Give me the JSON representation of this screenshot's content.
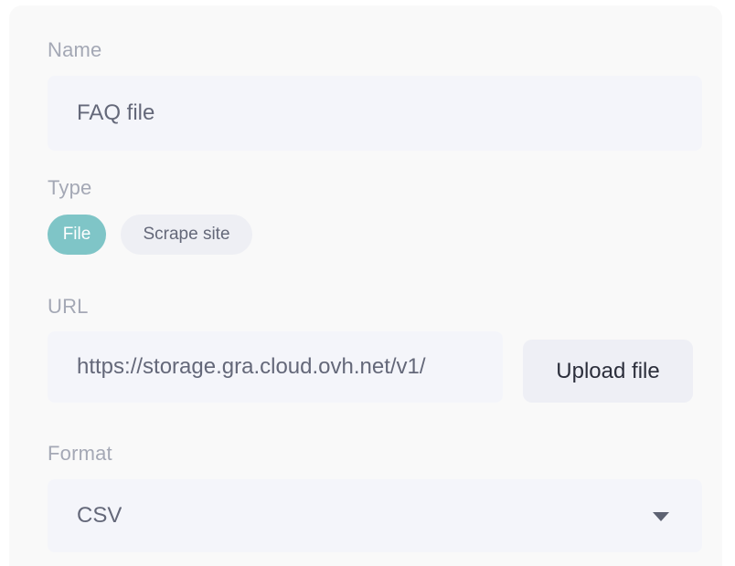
{
  "form": {
    "name": {
      "label": "Name",
      "value": "FAQ file"
    },
    "type": {
      "label": "Type",
      "options": [
        {
          "label": "File",
          "selected": true
        },
        {
          "label": "Scrape site",
          "selected": false
        }
      ]
    },
    "url": {
      "label": "URL",
      "value": "https://storage.gra.cloud.ovh.net/v1/",
      "upload_label": "Upload file"
    },
    "format": {
      "label": "Format",
      "value": "CSV",
      "icon": "chevron-down-icon"
    }
  },
  "colors": {
    "accent": "#7fc5c7",
    "field_bg": "#f4f5fa",
    "label_text": "#a4a8b5"
  }
}
